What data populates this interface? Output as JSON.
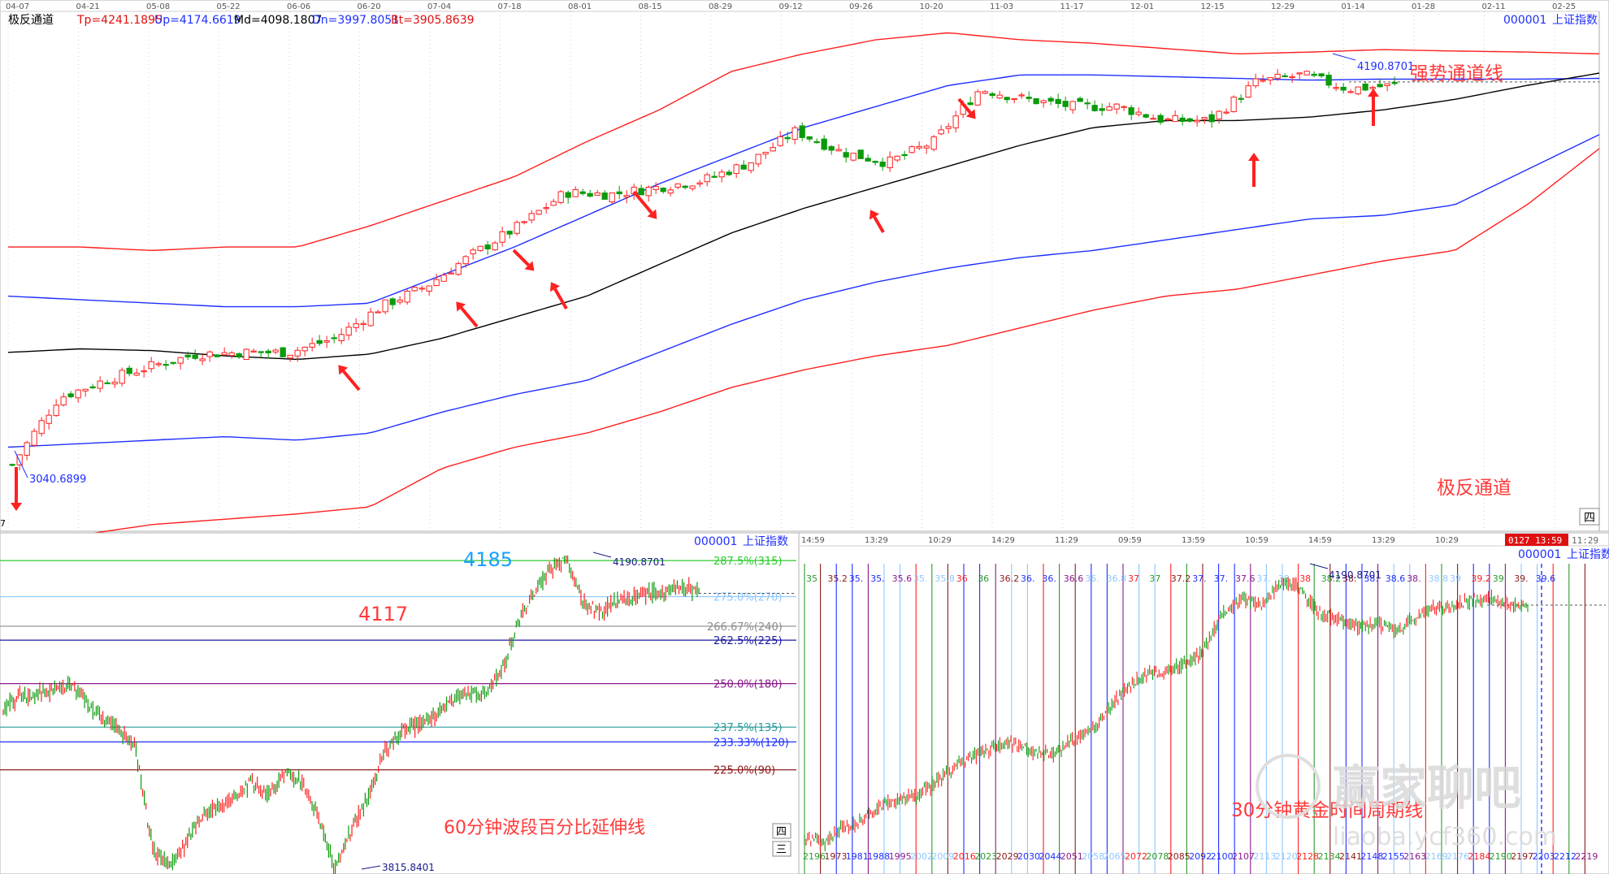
{
  "colors": {
    "up": "#ff1f1f",
    "down": "#0a9a0a",
    "outer": "#ff1f1f",
    "inner": "#1f2fff",
    "mid": "#000000",
    "grid": "#b9c3d6",
    "brand_blue": "#1f2fff",
    "annot_red": "#ff3b3b",
    "annot_blue": "#1aa0ff"
  },
  "main_panel": {
    "symbol_label": "000001",
    "index_label": "上证指数",
    "indicator_name": "极反通道",
    "stats": {
      "tp": "Tp=4241.1895",
      "up": "Up=4174.6619",
      "md": "Md=4098.1807",
      "dn": "Dn=3997.8051",
      "bt": "Bt=3905.8639"
    },
    "date_ticks": [
      "04-07",
      "04-21",
      "05-08",
      "05-22",
      "06-06",
      "06-20",
      "07-04",
      "07-18",
      "08-01",
      "08-15",
      "08-29",
      "09-12",
      "09-26",
      "10-20",
      "11-03",
      "11-17",
      "12-01",
      "12-15",
      "12-29",
      "01-14",
      "01-28",
      "02-11",
      "02-25"
    ],
    "low_label": "3040.6899",
    "high_label": "4190.8701",
    "annotation_strong": "强势通道线",
    "annotation_bottom": "极反通道",
    "corner_button": "四",
    "left_edge_digit": "7"
  },
  "left_sub": {
    "symbol_label": "000001",
    "index_label": "上证指数",
    "annot_blue": "4185",
    "annot_red": "4117",
    "title": "60分钟波段百分比延伸线",
    "high_label": "4190.8701",
    "low_label": "3815.8401",
    "corner_button": "四",
    "corner_button2": "三"
  },
  "right_sub": {
    "symbol_label": "000001",
    "index_label": "上证指数",
    "title": "30分钟黄金时间周期线",
    "time_ticks": [
      "14:59",
      "13:29",
      "10:29",
      "14:29",
      "11:29",
      "09:59",
      "13:59",
      "10:59",
      "14:59",
      "13:29",
      "10:29"
    ],
    "cursor_time": "0127 13:59",
    "cursor_time_after": "11:29",
    "high_label": "4190.8701",
    "watermark": "赢家聊吧",
    "watermark_url": "liaoba.ycf360.com",
    "top_labels": [
      "35",
      "35.2",
      "35.",
      "35.",
      "35.6",
      "35.",
      "35.8",
      "36",
      "36",
      "36.2",
      "36.",
      "36.",
      "36.6",
      "36.",
      "36.8",
      "37",
      "37",
      "37.2",
      "37.",
      "37.",
      "37.6",
      "37.",
      "38",
      "38",
      "38.2",
      "38.",
      "38.",
      "38.6",
      "38.",
      "38.8",
      "39",
      "39.2",
      "39.",
      "39.",
      "39.6"
    ],
    "bottom_labels": [
      "2196",
      "1973",
      "1981",
      "1988",
      "1995",
      "2002",
      "2009",
      "2016",
      "2023",
      "2029",
      "2030",
      "2044",
      "2051",
      "2058",
      "2065",
      "2072",
      "2078",
      "2085",
      "2092",
      "2100",
      "2107",
      "2113",
      "2120",
      "2128",
      "2134",
      "2141",
      "2148",
      "2155",
      "2163",
      "2169",
      "2176",
      "2184",
      "2190",
      "2197",
      "2203",
      "2212",
      "2219"
    ]
  },
  "chart_data": [
    {
      "type": "candlestick",
      "name": "极反通道",
      "ylim": [
        2900,
        4320
      ],
      "x": [
        "04-07",
        "04-21",
        "05-08",
        "05-22",
        "06-06",
        "06-20",
        "07-04",
        "07-18",
        "08-01",
        "08-15",
        "08-29",
        "09-12",
        "09-26",
        "10-20",
        "11-03",
        "11-17",
        "12-01",
        "12-15",
        "12-29",
        "01-14",
        "01-28",
        "02-11",
        "02-25"
      ],
      "channels": {
        "outer_upper": [
          3700,
          3700,
          3690,
          3700,
          3700,
          3760,
          3830,
          3900,
          4000,
          4090,
          4200,
          4250,
          4290,
          4310,
          4290,
          4280,
          4265,
          4250,
          4255,
          4262,
          4258,
          4255,
          4250
        ],
        "inner_upper": [
          3560,
          3550,
          3540,
          3530,
          3530,
          3540,
          3620,
          3700,
          3790,
          3880,
          3960,
          4040,
          4100,
          4160,
          4190,
          4190,
          4185,
          4180,
          4175,
          4178,
          4178,
          4178,
          4180
        ],
        "middle": [
          3400,
          3410,
          3405,
          3390,
          3380,
          3395,
          3440,
          3500,
          3560,
          3650,
          3740,
          3810,
          3870,
          3930,
          3990,
          4040,
          4060,
          4060,
          4070,
          4090,
          4120,
          4160,
          4195
        ],
        "inner_lower": [
          3130,
          3140,
          3150,
          3160,
          3150,
          3170,
          3230,
          3280,
          3320,
          3400,
          3480,
          3550,
          3600,
          3640,
          3670,
          3690,
          3720,
          3750,
          3780,
          3790,
          3820,
          3920,
          4020
        ],
        "outer_lower": [
          2860,
          2880,
          2910,
          2925,
          2940,
          2960,
          3070,
          3130,
          3170,
          3230,
          3300,
          3350,
          3390,
          3420,
          3470,
          3520,
          3560,
          3580,
          3620,
          3660,
          3690,
          3820,
          3980
        ]
      },
      "close_path": [
        3080,
        3270,
        3320,
        3360,
        3395,
        3400,
        3400,
        3440,
        3530,
        3590,
        3680,
        3760,
        3855,
        3850,
        3870,
        3890,
        3940,
        4030,
        3970,
        3940,
        4000,
        4150,
        4120,
        4100,
        4100,
        4060,
        4060,
        4170,
        4190,
        4150,
        4160
      ],
      "stats": {
        "Tp": 4241.1895,
        "Up": 4174.6619,
        "Md": 4098.1807,
        "Dn": 3997.8051,
        "Bt": 3905.8639
      },
      "high": 4190.8701,
      "low": 3040.6899
    },
    {
      "type": "line",
      "name": "60分钟波段百分比延伸线",
      "ylim": [
        3810,
        4200
      ],
      "levels": [
        {
          "label": "287.5%(315)",
          "value": 4190,
          "color": "#2ecc2e"
        },
        {
          "label": "275.0%(270)",
          "value": 4146,
          "color": "#8fc8ff"
        },
        {
          "label": "266.67%(240)",
          "value": 4110,
          "color": "#8c8c8c"
        },
        {
          "label": "262.5%(225)",
          "value": 4093,
          "color": "#1a1aa0"
        },
        {
          "label": "250.0%(180)",
          "value": 4040,
          "color": "#8b1a8b"
        },
        {
          "label": "237.5%(135)",
          "value": 3987,
          "color": "#2a9a9a"
        },
        {
          "label": "233.33%(120)",
          "value": 3969,
          "color": "#1f2fff"
        },
        {
          "label": "225.0%(90)",
          "value": 3935,
          "color": "#8b1a1a"
        }
      ],
      "price_path": [
        4010,
        4025,
        4028,
        4030,
        4038,
        4020,
        3995,
        3985,
        3960,
        3840,
        3815,
        3845,
        3880,
        3890,
        3900,
        3920,
        3905,
        3930,
        3920,
        3880,
        3815,
        3860,
        3900,
        3955,
        3980,
        3990,
        4000,
        4020,
        4030,
        4025,
        4050,
        4110,
        4150,
        4180,
        4190,
        4140,
        4125,
        4140,
        4145,
        4150,
        4150,
        4160,
        4150
      ],
      "high": 4190.8701,
      "low": 3815.8401
    },
    {
      "type": "line",
      "name": "30分钟黄金时间周期线",
      "ylim": [
        3800,
        4200
      ],
      "price_path": [
        3830,
        3825,
        3845,
        3855,
        3875,
        3885,
        3890,
        3910,
        3930,
        3945,
        3955,
        3960,
        3950,
        3945,
        3965,
        3975,
        4010,
        4040,
        4055,
        4060,
        4070,
        4090,
        4140,
        4160,
        4150,
        4180,
        4175,
        4140,
        4130,
        4120,
        4125,
        4115,
        4130,
        4145,
        4150,
        4155,
        4160,
        4150,
        4150
      ]
    }
  ]
}
